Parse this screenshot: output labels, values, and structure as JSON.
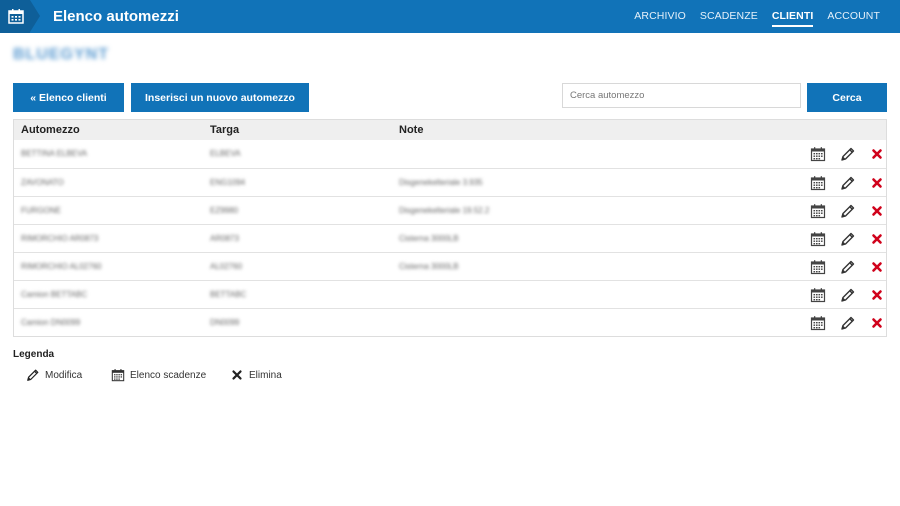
{
  "header": {
    "title": "Elenco automezzi",
    "nav": [
      {
        "label": "ARCHIVIO",
        "active": false
      },
      {
        "label": "SCADENZE",
        "active": false
      },
      {
        "label": "CLIENTI",
        "active": true
      },
      {
        "label": "ACCOUNT",
        "active": false
      }
    ]
  },
  "client": {
    "name": "BLUEGYNT"
  },
  "toolbar": {
    "back_label": "« Elenco clienti",
    "new_label": "Inserisci un nuovo automezzo",
    "search_placeholder": "Cerca automezzo",
    "search_label": "Cerca"
  },
  "table": {
    "columns": [
      "Automezzo",
      "Targa",
      "Note"
    ],
    "rows": [
      {
        "automezzo": "BETTINA ELBEVA",
        "targa": "ELBEVA",
        "note": ""
      },
      {
        "automezzo": "ZAVONATO",
        "targa": "ENG1094",
        "note": "Disgenekelteriale 3.935"
      },
      {
        "automezzo": "FURGONE",
        "targa": "EZ9980",
        "note": "Disgenekelteriale 19.52.2"
      },
      {
        "automezzo": "RIMORCHIO AR0873",
        "targa": "AR0873",
        "note": "Cisterna 3000LB"
      },
      {
        "automezzo": "RIMORCHIO AL02760",
        "targa": "AL02760",
        "note": "Cisterna 3000LB"
      },
      {
        "automezzo": "Camion BETTABC",
        "targa": "BETTABC",
        "note": ""
      },
      {
        "automezzo": "Camion DN0099",
        "targa": "DN0099",
        "note": ""
      }
    ]
  },
  "legend": {
    "title": "Legenda",
    "edit_label": "Modifica",
    "deadlines_label": "Elenco scadenze",
    "delete_label": "Elimina"
  },
  "colors": {
    "primary": "#1173b8",
    "delete": "#d0021b"
  }
}
